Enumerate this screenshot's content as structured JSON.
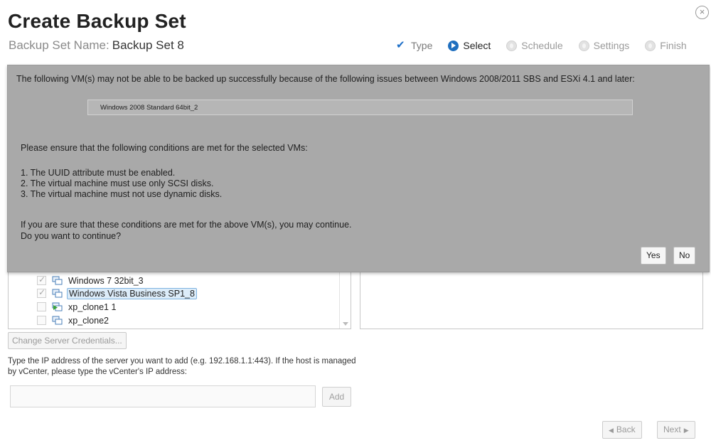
{
  "header": {
    "title": "Create Backup Set",
    "set_name_label": "Backup Set Name:",
    "set_name_value": "Backup Set 8",
    "close_glyph": "×"
  },
  "steps": [
    {
      "label": "Type",
      "state": "done"
    },
    {
      "label": "Select",
      "state": "active"
    },
    {
      "label": "Schedule",
      "state": "pending"
    },
    {
      "label": "Settings",
      "state": "pending"
    },
    {
      "label": "Finish",
      "state": "pending"
    }
  ],
  "warning": {
    "message": "The following VM(s) may not be able to be backed up successfully because of the following issues between Windows 2008/2011 SBS and ESXi 4.1 and later:",
    "vm_list": "Windows 2008 Standard 64bit_2",
    "ensure": "Please ensure that the following conditions are met for the selected VMs:",
    "conditions": [
      "1. The UUID attribute must be enabled.",
      "2. The virtual machine must use only SCSI disks.",
      "3. The virtual machine must not use dynamic disks."
    ],
    "confirm_line1": "If you are sure that these conditions are met for the above VM(s), you may continue.",
    "confirm_line2": "Do you want to continue?",
    "yes_label": "Yes",
    "no_label": "No"
  },
  "tree": {
    "items": [
      {
        "label": "Windows 7 32bit_3",
        "checked": true,
        "selected": false,
        "icon": "vm-icon"
      },
      {
        "label": "Windows Vista Business SP1_8",
        "checked": true,
        "selected": true,
        "icon": "vm-icon"
      },
      {
        "label": "xp_clone1 1",
        "checked": false,
        "selected": false,
        "icon": "vm-running-icon"
      },
      {
        "label": "xp_clone2",
        "checked": false,
        "selected": false,
        "icon": "vm-icon"
      }
    ]
  },
  "credentials_label": "Change Server Credentials...",
  "ip_hint": "Type the IP address of the server you want to add (e.g. 192.168.1.1:443). If the host is managed by vCenter, please type the vCenter's IP address:",
  "ip_input": {
    "value": "",
    "placeholder": ""
  },
  "add_label": "Add",
  "nav": {
    "back_label": "Back",
    "next_label": "Next"
  },
  "colors": {
    "accent": "#1f6fbf",
    "overlay": "#a9a9a9",
    "selection": "#dcecf9"
  }
}
